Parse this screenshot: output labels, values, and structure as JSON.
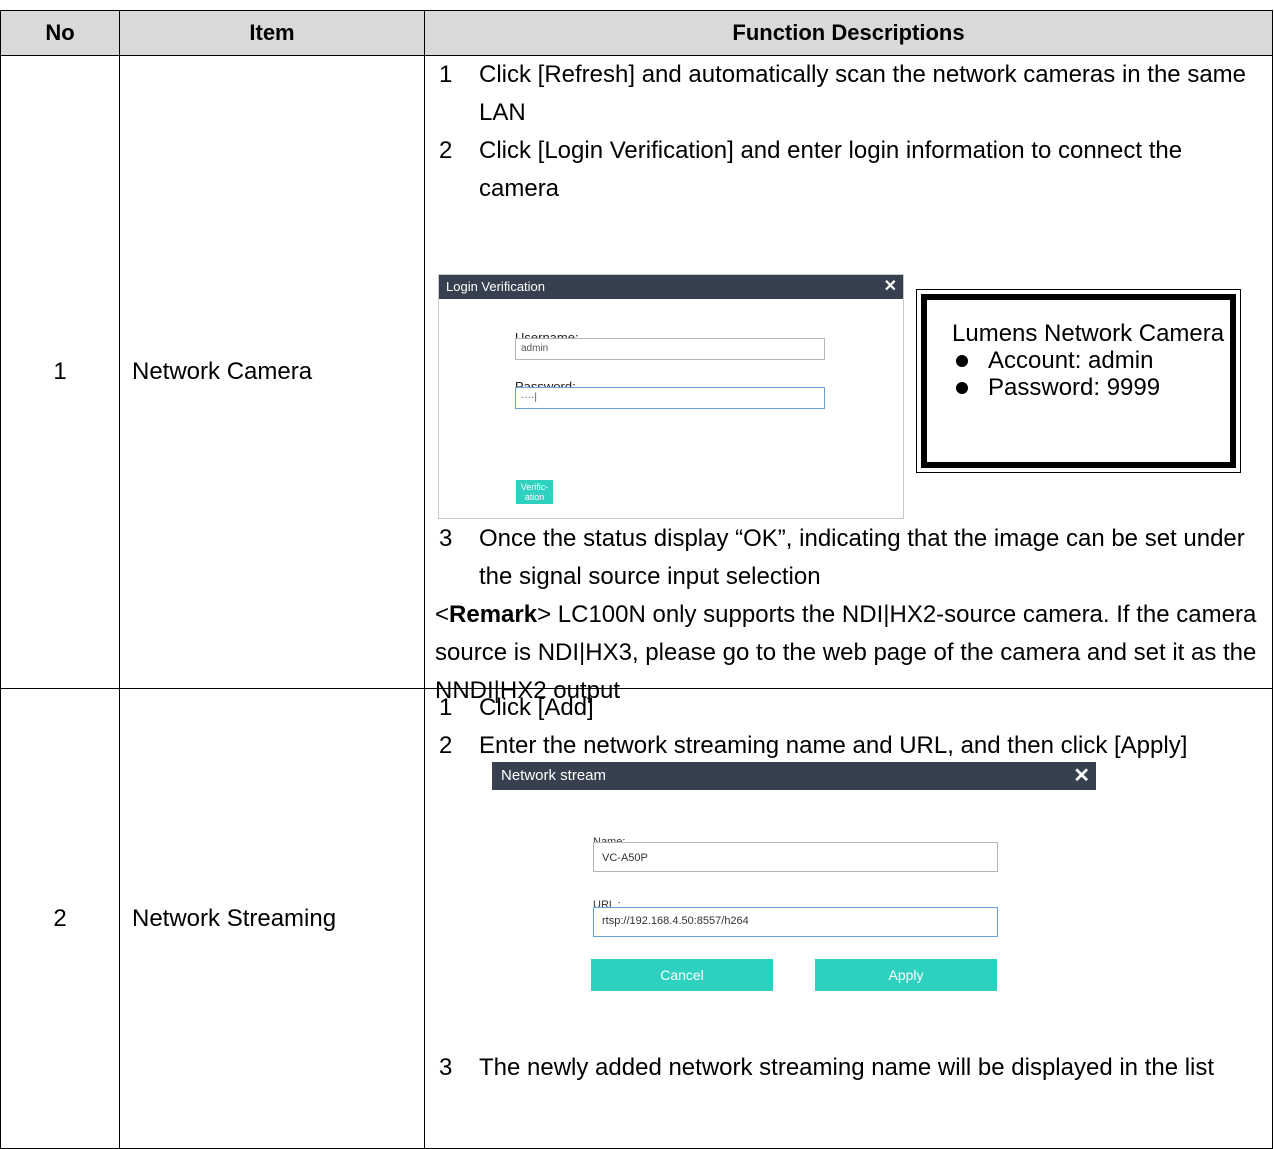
{
  "table": {
    "headers": {
      "no": "No",
      "item": "Item",
      "desc": "Function Descriptions"
    }
  },
  "rows": [
    {
      "no": "1",
      "item": "Network Camera",
      "steps": [
        {
          "num": "1",
          "text": "Click [Refresh] and automatically scan the network cameras in the same LAN"
        },
        {
          "num": "2",
          "text": "Click [Login Verification] and enter login information to connect the camera"
        }
      ],
      "login_dialog": {
        "title": "Login Verification",
        "username_label": "Username:",
        "username_value": "admin",
        "password_label": "Password:",
        "password_value": "····|",
        "verify_button": "Verific-ation"
      },
      "note": {
        "title": "Lumens Network Camera",
        "items": [
          "Account: admin",
          "Password: 9999"
        ]
      },
      "step3": {
        "num": "3",
        "text": "Once the status display “OK”, indicating that the image can be set under the signal source input selection"
      },
      "remark": {
        "open": "<",
        "label": "Remark",
        "text": "> LC100N only supports the NDI|HX2-source camera. If the camera source is NDI|HX3, please go to the web page of the camera and set it as the NNDI|HX2 output"
      }
    },
    {
      "no": "2",
      "item": "Network Streaming",
      "steps": [
        {
          "num": "1",
          "text": "Click [Add]"
        },
        {
          "num": "2",
          "text": "Enter the network streaming name and URL, and then click [Apply]"
        }
      ],
      "stream_dialog": {
        "title": "Network stream",
        "name_label": "Name:",
        "name_value": "VC-A50P",
        "url_label": "URL :",
        "url_value": "rtsp://192.168.4.50:8557/h264",
        "cancel_button": "Cancel",
        "apply_button": "Apply"
      },
      "step3": {
        "num": "3",
        "text": "The newly added network streaming name will be displayed in the list"
      }
    }
  ],
  "colors": {
    "header_bg": "#d9d9d9",
    "dialog_bar": "#37404f",
    "accent_teal": "#2ed1c0"
  }
}
